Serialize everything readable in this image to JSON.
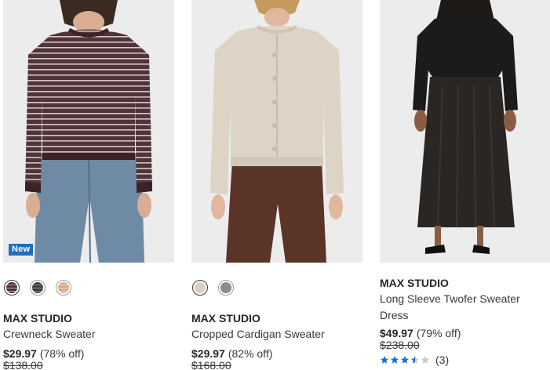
{
  "products": [
    {
      "brand": "MAX STUDIO",
      "name": "Crewneck Sweater",
      "price": "$29.97",
      "discount": "(78% off)",
      "original_price": "$138.00",
      "badge": "New",
      "image": "striped-crewneck-sweater-photo",
      "swatches": [
        {
          "color": "#4a2f33",
          "accent": "#c8a7a7",
          "selected": true
        },
        {
          "color": "#3b3e44",
          "accent": "#8d9299",
          "selected": false
        },
        {
          "color": "#d9a888",
          "accent": "#f1d7c2",
          "selected": false
        }
      ]
    },
    {
      "brand": "MAX STUDIO",
      "name": "Cropped Cardigan Sweater",
      "price": "$29.97",
      "discount": "(82% off)",
      "original_price": "$168.00",
      "image": "cream-cardigan-photo",
      "swatches": [
        {
          "color": "#d9cfc2",
          "selected": true
        },
        {
          "color": "#8c8c8c",
          "selected": false
        }
      ]
    },
    {
      "brand": "MAX STUDIO",
      "name": "Long Sleeve Twofer Sweater Dress",
      "price": "$49.97",
      "discount": "(79% off)",
      "original_price": "$238.00",
      "image": "black-sweater-dress-photo",
      "rating": 3.5,
      "review_count": "(3)"
    }
  ],
  "colors": {
    "badge": "#1f6fc2",
    "star_filled": "#1f6fc2",
    "star_empty": "#c9c9c9"
  }
}
